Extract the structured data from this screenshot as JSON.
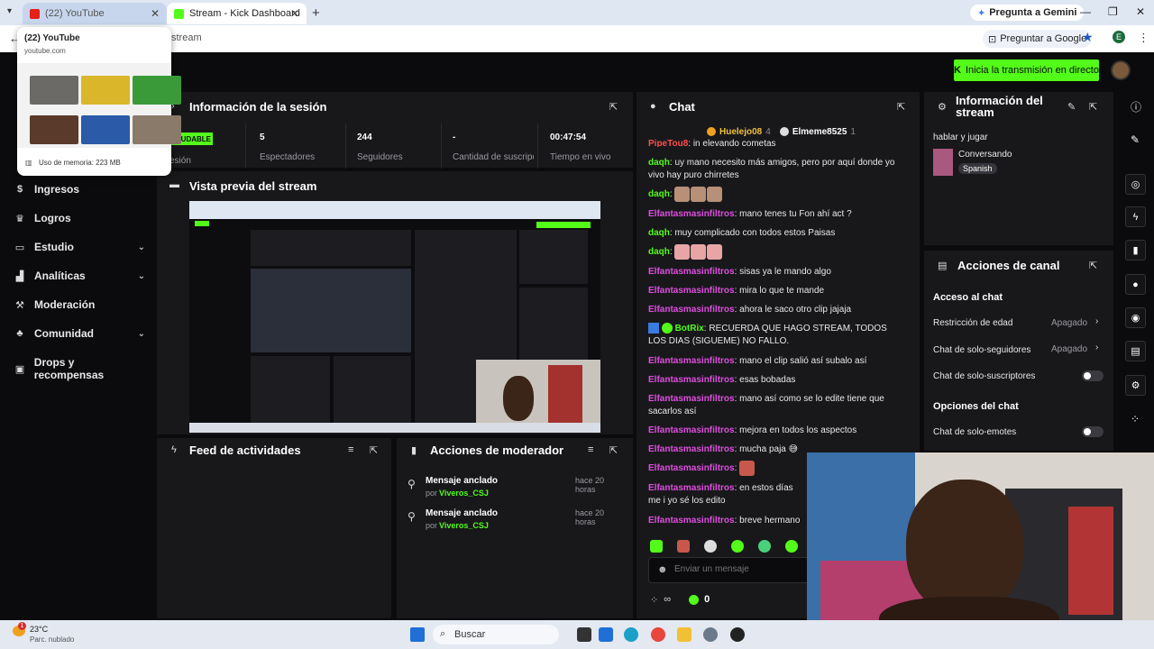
{
  "browser": {
    "tabs": [
      {
        "label": "(22) YouTube"
      },
      {
        "label": "Stream - Kick Dashboard"
      }
    ],
    "gemini_label": "Pregunta a Gemini",
    "url_fragment": "stream",
    "ask_google_label": "Preguntar a Google",
    "profile_initial": "E",
    "hover_card": {
      "title": "(22) YouTube",
      "domain": "youtube.com",
      "memory": "Uso de memoria: 223 MB"
    }
  },
  "header": {
    "go_live_label": "Inicia la transmisión en directo"
  },
  "sidebar": {
    "items": [
      {
        "label": "Ingresos",
        "icon": "dollar-icon"
      },
      {
        "label": "Logros",
        "icon": "trophy-icon"
      },
      {
        "label": "Estudio",
        "icon": "studio-icon",
        "expandable": true
      },
      {
        "label": "Analíticas",
        "icon": "chart-icon",
        "expandable": true
      },
      {
        "label": "Moderación",
        "icon": "hammer-icon"
      },
      {
        "label": "Comunidad",
        "icon": "community-icon",
        "expandable": true
      },
      {
        "label": "Drops y recompensas",
        "icon": "gift-icon"
      }
    ]
  },
  "session": {
    "title": "Información de la sesión",
    "health": "ALUDABLE",
    "health_label": "esión",
    "stats": [
      {
        "value": "5",
        "label": "Espectadores"
      },
      {
        "value": "244",
        "label": "Seguidores"
      },
      {
        "value": "-",
        "label": "Cantidad de suscripciones"
      },
      {
        "value": "00:47:54",
        "label": "Tiempo en vivo"
      }
    ]
  },
  "preview": {
    "title": "Vista previa del stream"
  },
  "activity_feed": {
    "title": "Feed de actividades"
  },
  "mod_actions": {
    "title": "Acciones de moderador",
    "items": [
      {
        "title": "Mensaje anclado",
        "by_prefix": "por",
        "by": "Viveros_CSJ",
        "time": "hace 20 horas"
      },
      {
        "title": "Mensaje anclado",
        "by_prefix": "por",
        "by": "Viveros_CSJ",
        "time": "hace 20 horas"
      }
    ]
  },
  "chat": {
    "title": "Chat",
    "pinned_users": [
      {
        "name": "Huelejo08",
        "count": "4"
      },
      {
        "name": "Elmeme8525",
        "count": "1"
      }
    ],
    "messages": [
      {
        "user": "PipeTou8",
        "text": "in elevando cometas",
        "color": "red"
      },
      {
        "user": "daqh",
        "text": "uy mano necesito más amigos, pero por aquí donde yo vivo hay puro chirretes",
        "color": "green"
      },
      {
        "user": "daqh",
        "text": "",
        "color": "green",
        "emotes": 3
      },
      {
        "user": "Elfantasmasinfiltros",
        "text": "mano tenes tu Fon ahí act ?",
        "color": "pink"
      },
      {
        "user": "daqh",
        "text": "muy complicado con todos estos Paisas",
        "color": "green"
      },
      {
        "user": "daqh",
        "text": "",
        "color": "green",
        "emotes": 3
      },
      {
        "user": "Elfantasmasinfiltros",
        "text": "sisas ya le mando algo",
        "color": "pink"
      },
      {
        "user": "Elfantasmasinfiltros",
        "text": "mira lo que te mande",
        "color": "pink"
      },
      {
        "user": "Elfantasmasinfiltros",
        "text": "ahora le saco otro clip jajaja",
        "color": "pink"
      },
      {
        "user": "BotRix",
        "text": "RECUERDA QUE HAGO STREAM, TODOS LOS DIAS (SIGUEME) NO FALLO.",
        "color": "green"
      },
      {
        "user": "Elfantasmasinfiltros",
        "text": "mano el clip salió así subalo así",
        "color": "pink"
      },
      {
        "user": "Elfantasmasinfiltros",
        "text": "esas bobadas",
        "color": "pink"
      },
      {
        "user": "Elfantasmasinfiltros",
        "text": "mano así como se lo edite tiene que sacarlos así",
        "color": "pink"
      },
      {
        "user": "Elfantasmasinfiltros",
        "text": "mejora en todos los aspectos",
        "color": "pink"
      },
      {
        "user": "Elfantasmasinfiltros",
        "text": "mucha paja 😅",
        "color": "pink"
      },
      {
        "user": "Elfantasmasinfiltros",
        "text": "",
        "color": "pink",
        "emotes": 1
      },
      {
        "user": "Elfantasmasinfiltros",
        "text": "en estos días me i yo sé los edito",
        "color": "pink"
      },
      {
        "user": "Elfantasmasinfiltros",
        "text": "breve hermano",
        "color": "pink"
      }
    ],
    "input_placeholder": "Enviar un mensaje",
    "footer_count": "0",
    "footer_infinity": "∞"
  },
  "stream_info": {
    "title": "Información del stream",
    "stream_title": "hablar y jugar",
    "category": "Conversando",
    "language": "Spanish"
  },
  "channel_actions": {
    "title": "Acciones de canal",
    "sections": [
      {
        "heading": "Acceso al chat"
      },
      {
        "heading": "Opciones del chat"
      }
    ],
    "rows": [
      {
        "label": "Restricción de edad",
        "value": "Apagado"
      },
      {
        "label": "Chat de solo-seguidores",
        "value": "Apagado"
      },
      {
        "label": "Chat de solo-suscriptores",
        "value": ""
      },
      {
        "label": "Chat de solo-emotes",
        "value": ""
      }
    ]
  },
  "taskbar": {
    "weather_temp": "23°C",
    "weather_desc": "Parc. nublado",
    "search_label": "Buscar"
  },
  "colors": {
    "kick_green": "#53fc18",
    "panel_bg": "#18181b",
    "page_bg": "#0b0b0d",
    "chat_pink": "#e04de0"
  }
}
